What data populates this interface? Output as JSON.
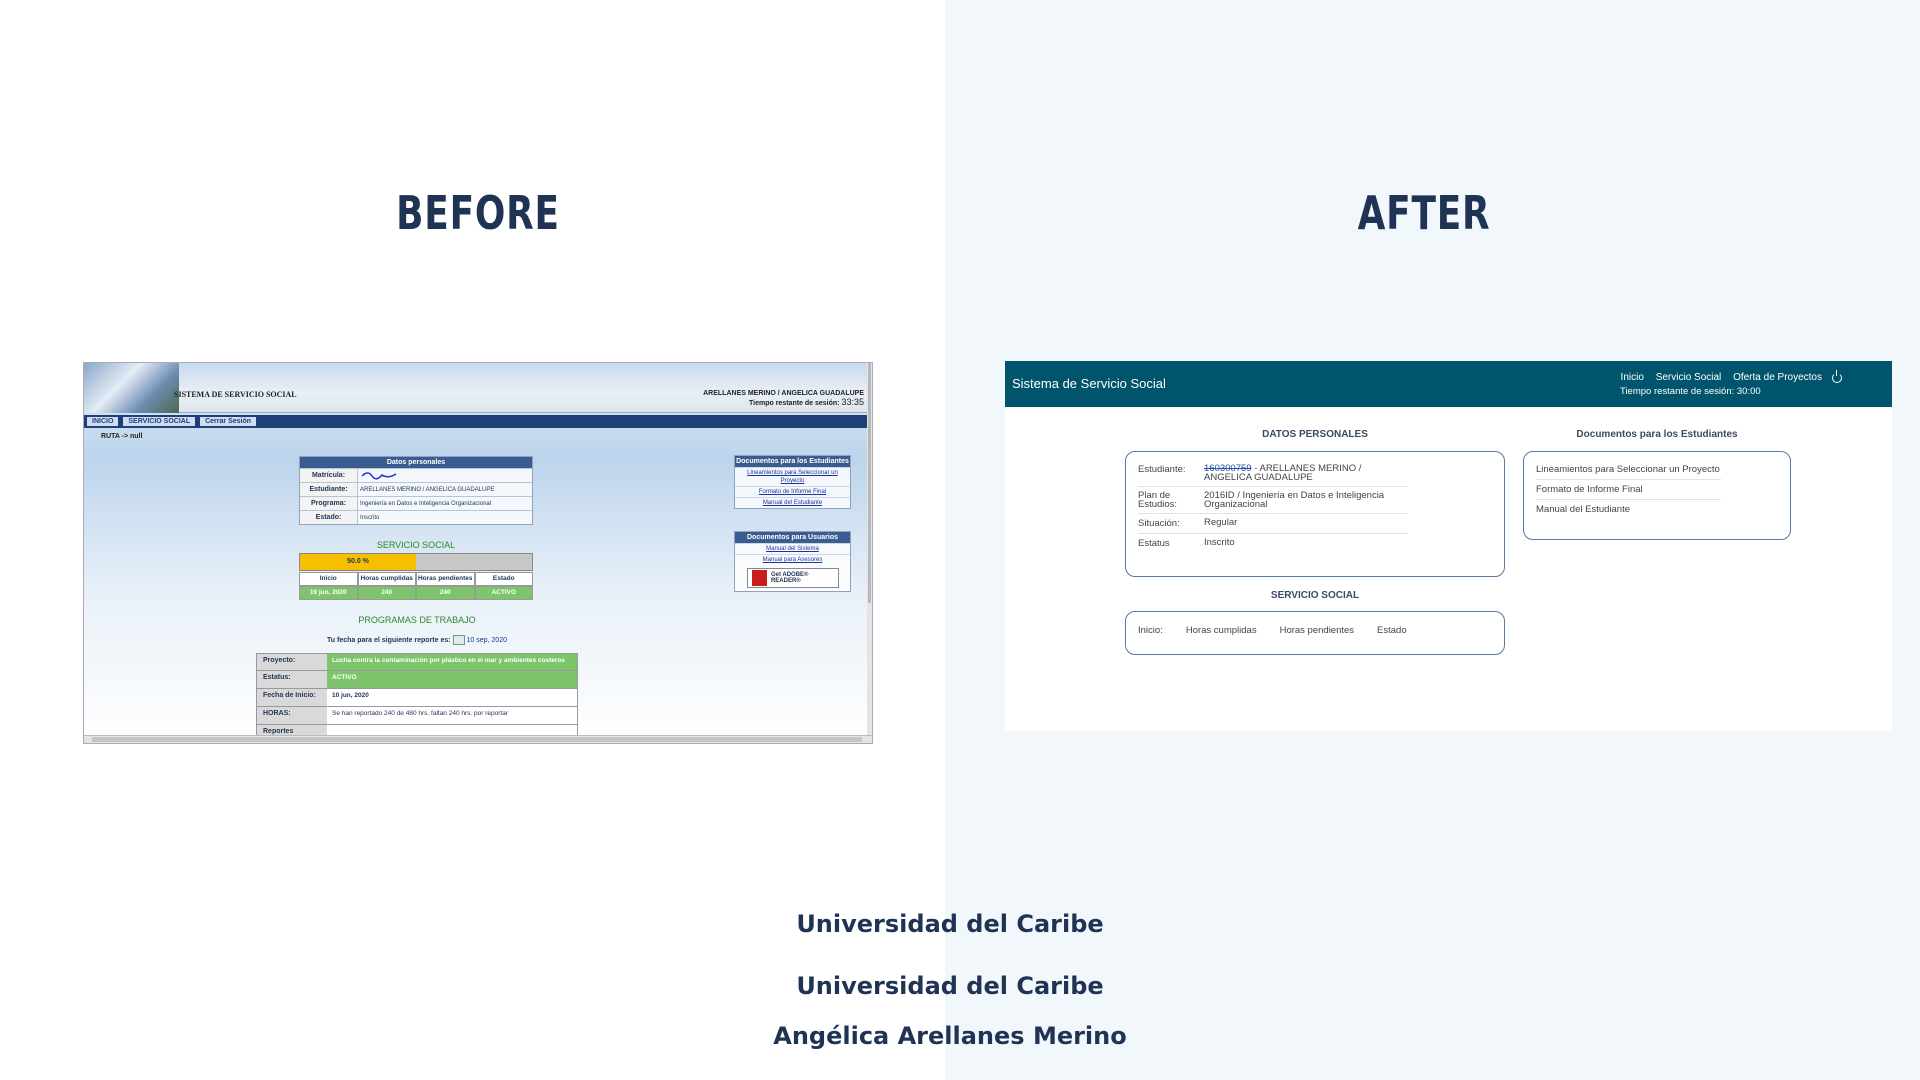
{
  "headings": {
    "before": "BEFORE",
    "after": "AFTER"
  },
  "old_app": {
    "system_title": "SISTEMA DE SERVICIO SOCIAL",
    "user_name": "ARELLANES MERINO / ANGELICA GUADALUPE",
    "session_label": "Tiempo restante de sesión:",
    "session_time": "33:35",
    "nav": [
      "INICIO",
      "SERVICIO SOCIAL",
      "Cerrar Sesión"
    ],
    "ruta": "RUTA -> null",
    "personal": {
      "title": "Datos personales",
      "rows": [
        {
          "k": "Matrícula:",
          "v": ""
        },
        {
          "k": "Estudiante:",
          "v": "ARELLANES MERINO / ANGELICA GUADALUPE"
        },
        {
          "k": "Programa:",
          "v": "Ingeniería en Datos e Inteligencia Organizacional"
        },
        {
          "k": "Estado:",
          "v": "Inscrito"
        }
      ]
    },
    "ss_title": "SERVICIO SOCIAL",
    "progress_label": "50.0 %",
    "progress": 0.5,
    "ss_headers": [
      "Inicio",
      "Horas cumplidas",
      "Horas pendientes",
      "Estado"
    ],
    "ss_values": [
      "19 jun, 2020",
      "240",
      "240",
      "ACTIVO"
    ],
    "programs_title": "PROGRAMAS DE TRABAJO",
    "next_report_label": "Tu fecha para el siguiente reporte es:",
    "next_report_date": "10 sep, 2020",
    "project_rows": [
      {
        "k": "Proyecto:",
        "v": "Lucha contra la contaminación por plástico en el mar y ambientes costeros",
        "green": true
      },
      {
        "k": "Estatus:",
        "v": "ACTIVO",
        "green": true
      },
      {
        "k": "Fecha de Inicio:",
        "v": "10 jun, 2020",
        "green": false
      },
      {
        "k": "HORAS:",
        "v": "Se han reportado 240 de 480 hrs. faltan 240 hrs. por reportar",
        "green": false
      },
      {
        "k": "Reportes",
        "v": "",
        "green": false
      }
    ],
    "docs_students": {
      "title": "Documentos para los Estudiantes",
      "links": [
        "Lineamientos para Seleccionar un Proyecto",
        "Formato de Informe Final",
        "Manual del Estudiante"
      ]
    },
    "docs_users": {
      "title": "Documentos para Usuarios",
      "links": [
        "Manual del Sistema",
        "Manual para Asesores"
      ]
    },
    "adobe": "Get ADOBE® READER®"
  },
  "new_app": {
    "title": "Sistema de Servicio Social",
    "nav": [
      "Inicio",
      "Servicio Social",
      "Oferta de Proyectos"
    ],
    "session": "Tiempo restante de sesión: 30:00",
    "personal_title": "DATOS PERSONALES",
    "personal_rows": [
      {
        "k": "Estudiante:",
        "v_strike": "160300759",
        "v": " - ARELLANES MERINO / ANGELICA GUADALUPE"
      },
      {
        "k": "Plan de Estudios:",
        "v_strike": "",
        "v": "2016ID / Ingeniería en Datos e Inteligencia Organizacional"
      },
      {
        "k": "Situación:",
        "v_strike": "",
        "v": "Regular"
      },
      {
        "k": "Estatus",
        "v_strike": "",
        "v": "Inscrito"
      }
    ],
    "docs_title": "Documentos para los Estudiantes",
    "docs": [
      "Lineamientos para Seleccionar un Proyecto",
      "Formato de Informe Final",
      "Manual del Estudiante"
    ],
    "ss_title": "SERVICIO SOCIAL",
    "ss_fields": [
      "Inicio:",
      "Horas cumplidas",
      "Horas pendientes",
      "Estado"
    ]
  },
  "footer": {
    "line1": "Universidad del Caribe",
    "line2": "Universidad del Caribe",
    "line3": "Angélica Arellanes Merino"
  }
}
